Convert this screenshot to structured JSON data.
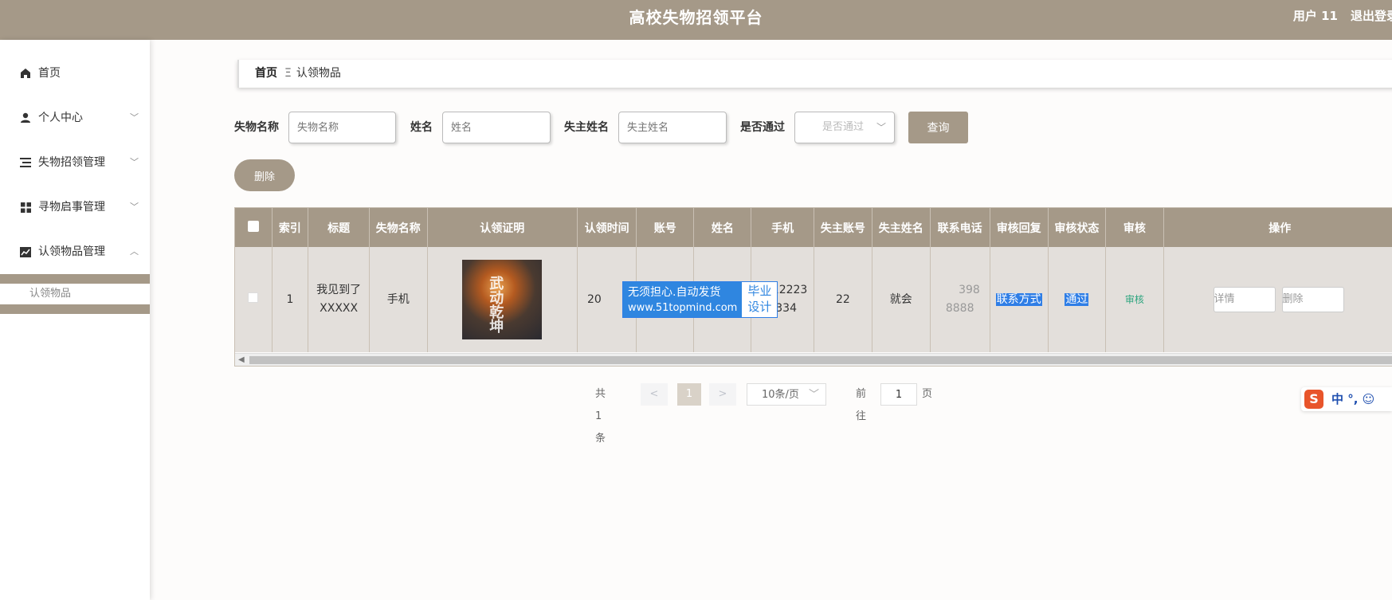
{
  "header": {
    "title": "高校失物招领平台",
    "user": "用户 11",
    "logout": "退出登录"
  },
  "sidebar": {
    "items": [
      {
        "label": "首页",
        "icon": "home-icon"
      },
      {
        "label": "个人中心",
        "icon": "person-icon"
      },
      {
        "label": "失物招领管理",
        "icon": "list-icon"
      },
      {
        "label": "寻物启事管理",
        "icon": "grid-icon"
      },
      {
        "label": "认领物品管理",
        "icon": "chart-icon"
      }
    ],
    "sub_item": "认领物品"
  },
  "breadcrumb": {
    "home": "首页",
    "current": "认领物品"
  },
  "search": {
    "item_name_label": "失物名称",
    "item_name_placeholder": "失物名称",
    "name_label": "姓名",
    "name_placeholder": "姓名",
    "owner_label": "失主姓名",
    "owner_placeholder": "失主姓名",
    "passed_label": "是否通过",
    "passed_placeholder": "是否通过",
    "query_label": "查询"
  },
  "toolbar": {
    "delete_label": "删除"
  },
  "table": {
    "headers": [
      "索引",
      "标题",
      "失物名称",
      "认领证明",
      "认领时间",
      "账号",
      "姓名",
      "手机",
      "失主账号",
      "失主姓名",
      "联系电话",
      "审核回复",
      "审核状态",
      "审核",
      "操作"
    ],
    "rows": [
      {
        "index": "1",
        "title_line1": "我见到了",
        "title_line2": "XXXXX",
        "item_name": "手机",
        "proof_text": "武动乾坤",
        "claim_time": "20",
        "account": "",
        "name": "",
        "phone_line1": "1112223",
        "phone_line2": "3334",
        "owner_account": "22",
        "owner_name": "就会",
        "contact_line1": "398",
        "contact_line2": "8888",
        "reply": "联系方式",
        "status": "通过",
        "audit": "审核",
        "detail": "详情",
        "delete": "删除"
      }
    ]
  },
  "watermark": {
    "left_line1": "无须担心.自动发货",
    "left_line2": "www.51topmind.com",
    "right_line1": "毕业",
    "right_line2": "设计"
  },
  "pagination": {
    "total": "共 1 条",
    "prev": "<",
    "current": "1",
    "next": ">",
    "page_size": "10条/页",
    "goto_label": "前往",
    "goto_value": "1",
    "page_suffix": "页"
  },
  "ime": {
    "logo": "S",
    "text": "中 °, ☺"
  },
  "colors": {
    "accent": "#a59988",
    "row_bg": "#e3dfdb",
    "highlight": "#2f7ee6",
    "audit_link": "#2ea57f"
  }
}
